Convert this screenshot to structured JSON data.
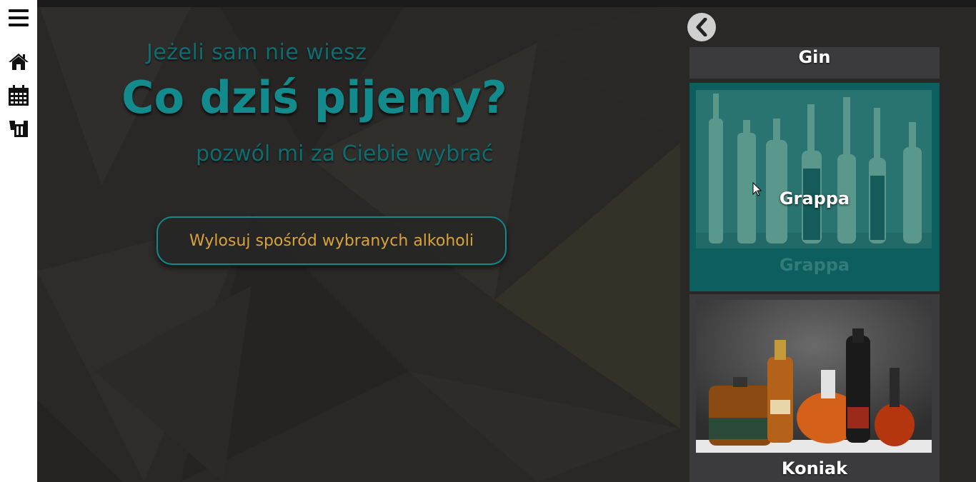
{
  "sidebar": {
    "items": [
      {
        "icon": "menu-icon"
      },
      {
        "icon": "home-icon"
      },
      {
        "icon": "calendar-icon"
      },
      {
        "icon": "beer-mug-icon"
      }
    ]
  },
  "hero": {
    "line1": "Jeżeli sam nie wiesz",
    "line2": "Co dziś pijemy?",
    "line3": "pozwól mi za Ciebie wybrać",
    "button_label": "Wylosuj spośród wybranych alkoholi"
  },
  "alcohol_list": {
    "back_icon": "chevron-left-icon",
    "items": [
      {
        "name": "Gin"
      },
      {
        "name": "Grappa"
      },
      {
        "name": "Koniak"
      }
    ]
  },
  "colors": {
    "accent": "#138a8b",
    "button_text": "#d9a23a",
    "background": "#2b2a29",
    "card": "#3b3b3d",
    "card_active": "#0d5f5f"
  }
}
